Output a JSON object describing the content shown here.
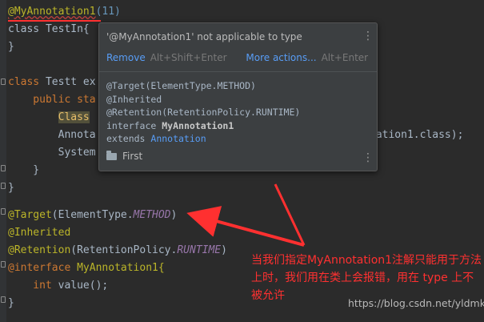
{
  "code": {
    "l1_ann": "@MyAnnotation1",
    "l1_args": "(11)",
    "l2": "class TestIn{",
    "l3": "}",
    "l5_kw": "class",
    "l5_name": " Testt ex",
    "l6": "    public sta",
    "l7_kw": "Class",
    "l8": "        Annota",
    "l8_tail": "tation1.class);",
    "l9": "        System",
    "l10": "    }",
    "l11": "}",
    "l13_ann": "@Target",
    "l13_open": "(ElementType.",
    "l13_const": "METHOD",
    "l13_close": ")",
    "l14": "@Inherited",
    "l15_ann": "@Retention",
    "l15_open": "(RetentionPolicy.",
    "l15_const": "RUNTIME",
    "l15_close": ")",
    "l16_kw": "@interface",
    "l16_name": " MyAnnotation1{",
    "l17_kw": "    int",
    "l17_rest": " value();",
    "l18": "}"
  },
  "popup": {
    "title": "'@MyAnnotation1' not applicable to type",
    "remove_label": "Remove",
    "remove_shortcut": "Alt+Shift+Enter",
    "more_label": "More actions...",
    "more_shortcut": "Alt+Enter",
    "doc_line1": "@Target(ElementType.METHOD)",
    "doc_line2": "@Inherited",
    "doc_line3": "@Retention(RetentionPolicy.RUNTIME)",
    "doc_line4_kw": "interface ",
    "doc_line4_name": "MyAnnotation1",
    "doc_line5_kw": "extends ",
    "doc_line5_link": "Annotation",
    "first_label": "First",
    "kebab": "⋮"
  },
  "annotation_note": "当我们指定MyAnnotation1注解只能用于方法上时，我们用在类上会报错，用在 type 上不被允许",
  "watermark": "https://blog.csdn.net/yldmkx",
  "colors": {
    "editor_bg": "#2b2b2b",
    "popup_bg": "#3c3f41",
    "annotation_red": "#ff3030",
    "link_blue": "#589df6",
    "error_underline": "#bc3f3c"
  }
}
